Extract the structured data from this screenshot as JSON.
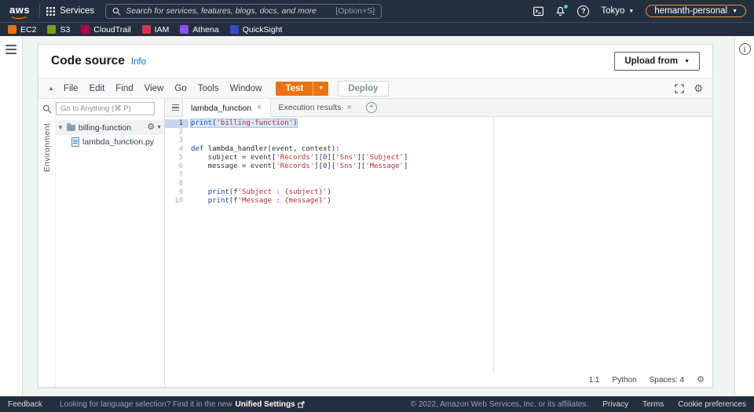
{
  "topnav": {
    "logo": "aws",
    "services": "Services",
    "search_placeholder": "Search for services, features, blogs, docs, and more",
    "search_shortcut": "[Option+S]",
    "region": "Tokyo",
    "account": "hemanth-personal"
  },
  "favorites": [
    {
      "label": "EC2",
      "color": "#ED7100"
    },
    {
      "label": "S3",
      "color": "#7AA116"
    },
    {
      "label": "CloudTrail",
      "color": "#B0084D"
    },
    {
      "label": "IAM",
      "color": "#DD344C"
    },
    {
      "label": "Athena",
      "color": "#8C4FFF"
    },
    {
      "label": "QuickSight",
      "color": "#3B48CC"
    }
  ],
  "colors": {
    "accent_orange": "#ec7211",
    "nav_dark": "#232f3e",
    "link_blue": "#0073bb"
  },
  "panel": {
    "title": "Code source",
    "info": "Info",
    "upload": "Upload from"
  },
  "menubar": {
    "menus": [
      "File",
      "Edit",
      "Find",
      "View",
      "Go",
      "Tools",
      "Window"
    ],
    "test": "Test",
    "deploy": "Deploy"
  },
  "sidebar": {
    "goto_placeholder": "Go to Anything (⌘ P)",
    "environment": "Environment",
    "folder": "billing-function",
    "file": "lambda_function.py"
  },
  "tabs": [
    {
      "label": "lambda_function",
      "active": true
    },
    {
      "label": "Execution results",
      "active": false
    }
  ],
  "status": {
    "cursor": "1:1",
    "language": "Python",
    "spaces": "Spaces: 4"
  },
  "code": {
    "lines": [
      {
        "selected": true,
        "tokens": [
          {
            "t": "print",
            "c": "k"
          },
          {
            "t": "(",
            "c": "d"
          },
          {
            "t": "'billing-function'",
            "c": "s"
          },
          {
            "t": ")",
            "c": "d"
          }
        ]
      },
      {
        "tokens": []
      },
      {
        "tokens": []
      },
      {
        "tokens": [
          {
            "t": "def ",
            "c": "k"
          },
          {
            "t": "lambda_handler",
            "c": "f"
          },
          {
            "t": "(event, context):",
            "c": "d"
          }
        ]
      },
      {
        "tokens": [
          {
            "t": "    subject = event[",
            "c": "d"
          },
          {
            "t": "'Records'",
            "c": "s"
          },
          {
            "t": "][",
            "c": "d"
          },
          {
            "t": "0",
            "c": "n"
          },
          {
            "t": "][",
            "c": "d"
          },
          {
            "t": "'Sns'",
            "c": "s"
          },
          {
            "t": "][",
            "c": "d"
          },
          {
            "t": "'Subject'",
            "c": "s"
          },
          {
            "t": "]",
            "c": "d"
          }
        ]
      },
      {
        "tokens": [
          {
            "t": "    message = event[",
            "c": "d"
          },
          {
            "t": "'Records'",
            "c": "s"
          },
          {
            "t": "][",
            "c": "d"
          },
          {
            "t": "0",
            "c": "n"
          },
          {
            "t": "][",
            "c": "d"
          },
          {
            "t": "'Sns'",
            "c": "s"
          },
          {
            "t": "][",
            "c": "d"
          },
          {
            "t": "'Message'",
            "c": "s"
          },
          {
            "t": "]",
            "c": "d"
          }
        ]
      },
      {
        "tokens": []
      },
      {
        "tokens": []
      },
      {
        "tokens": [
          {
            "t": "    ",
            "c": "d"
          },
          {
            "t": "print",
            "c": "k"
          },
          {
            "t": "(f",
            "c": "d"
          },
          {
            "t": "'Subject : {subject}'",
            "c": "s"
          },
          {
            "t": ")",
            "c": "d"
          }
        ]
      },
      {
        "tokens": [
          {
            "t": "    ",
            "c": "d"
          },
          {
            "t": "print",
            "c": "k"
          },
          {
            "t": "(f",
            "c": "d"
          },
          {
            "t": "'Message : {message}'",
            "c": "s"
          },
          {
            "t": ")",
            "c": "d"
          }
        ]
      }
    ]
  },
  "footer": {
    "feedback": "Feedback",
    "language_hint": "Looking for language selection? Find it in the new",
    "unified_settings": "Unified Settings",
    "copyright": "© 2022, Amazon Web Services, Inc. or its affiliates.",
    "privacy": "Privacy",
    "terms": "Terms",
    "cookies": "Cookie preferences"
  }
}
